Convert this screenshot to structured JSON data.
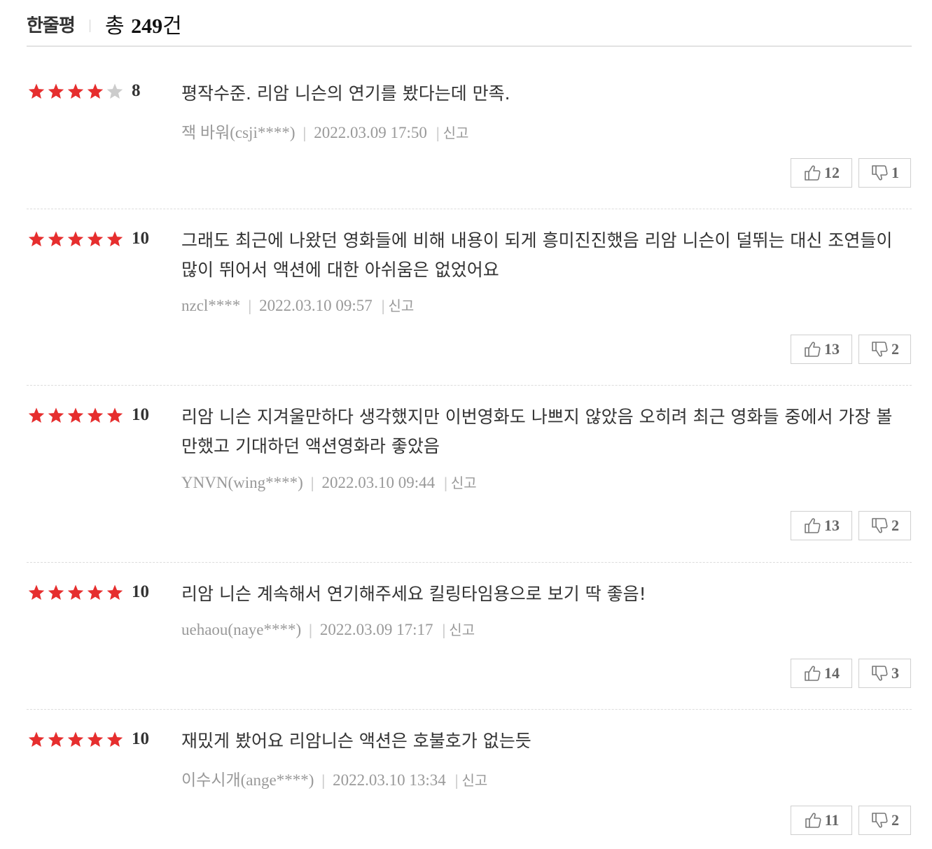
{
  "header": {
    "title": "한줄평",
    "total_prefix": "총 ",
    "total_count": "249",
    "total_suffix": "건"
  },
  "colors": {
    "star_on": "#e62e2e",
    "star_off": "#cccccc",
    "divider": "#e2e2e2"
  },
  "reviews": [
    {
      "stars": 4,
      "score": "8",
      "text": "평작수준. 리암 니슨의 연기를 봤다는데 만족.",
      "user": "잭 바워(csji****)",
      "date": "2022.03.09 17:50",
      "report": "신고",
      "likes": "12",
      "dislikes": "1"
    },
    {
      "stars": 5,
      "score": "10",
      "text": "그래도 최근에 나왔던 영화들에 비해 내용이 되게 흥미진진했음 리암 니슨이 덜뛰는 대신 조연들이 많이 뛰어서 액션에 대한 아쉬움은 없었어요",
      "user": "nzcl****",
      "date": "2022.03.10 09:57",
      "report": "신고",
      "likes": "13",
      "dislikes": "2"
    },
    {
      "stars": 5,
      "score": "10",
      "text": "리암 니슨 지겨울만하다 생각했지만 이번영화도 나쁘지 않았음 오히려 최근 영화들 중에서 가장 볼만했고 기대하던 액션영화라 좋았음",
      "user": "YNVN(wing****)",
      "date": "2022.03.10 09:44",
      "report": "신고",
      "likes": "13",
      "dislikes": "2"
    },
    {
      "stars": 5,
      "score": "10",
      "text": "리암 니슨 계속해서 연기해주세요 킬링타임용으로 보기 딱 좋음!",
      "user": "uehaou(naye****)",
      "date": "2022.03.09 17:17",
      "report": "신고",
      "likes": "14",
      "dislikes": "3"
    },
    {
      "stars": 5,
      "score": "10",
      "text": "재밌게 봤어요 리암니슨 액션은 호불호가 없는듯",
      "user": "이수시개(ange****)",
      "date": "2022.03.10 13:34",
      "report": "신고",
      "likes": "11",
      "dislikes": "2"
    }
  ]
}
